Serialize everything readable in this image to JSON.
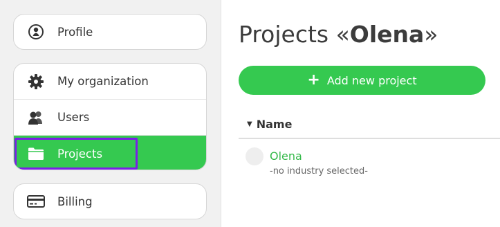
{
  "sidebar": {
    "profile": {
      "label": "Profile",
      "icon": "user-circle-icon"
    },
    "organization": {
      "label": "My organization",
      "icon": "gear-icon"
    },
    "users": {
      "label": "Users",
      "icon": "users-icon"
    },
    "projects": {
      "label": "Projects",
      "icon": "folder-icon",
      "active": true
    },
    "billing": {
      "label": "Billing",
      "icon": "credit-card-icon"
    }
  },
  "main": {
    "title_prefix": "Projects «",
    "title_name": "Olena",
    "title_suffix": "»",
    "add_button_label": "Add new project",
    "column_header": "Name",
    "projects": [
      {
        "name": "Olena",
        "industry": "-no industry selected-"
      }
    ]
  },
  "colors": {
    "accent": "#35c950",
    "focus": "#7a1fe6",
    "link": "#35b94a"
  }
}
